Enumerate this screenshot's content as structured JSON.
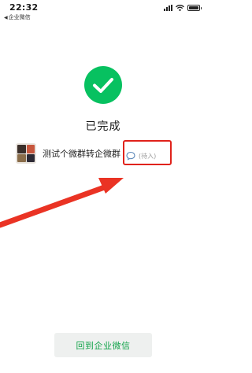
{
  "status_bar": {
    "time": "22:32",
    "back_app_label": "企业微信"
  },
  "result": {
    "title": "已完成",
    "accent_color": "#07c160"
  },
  "group": {
    "name": "测试个微群转企微群",
    "status_label": "待入"
  },
  "annotation": {
    "box_color": "#e0221b",
    "arrow_color": "#ea3324"
  },
  "footer": {
    "return_button_label": "回到企业微信"
  }
}
